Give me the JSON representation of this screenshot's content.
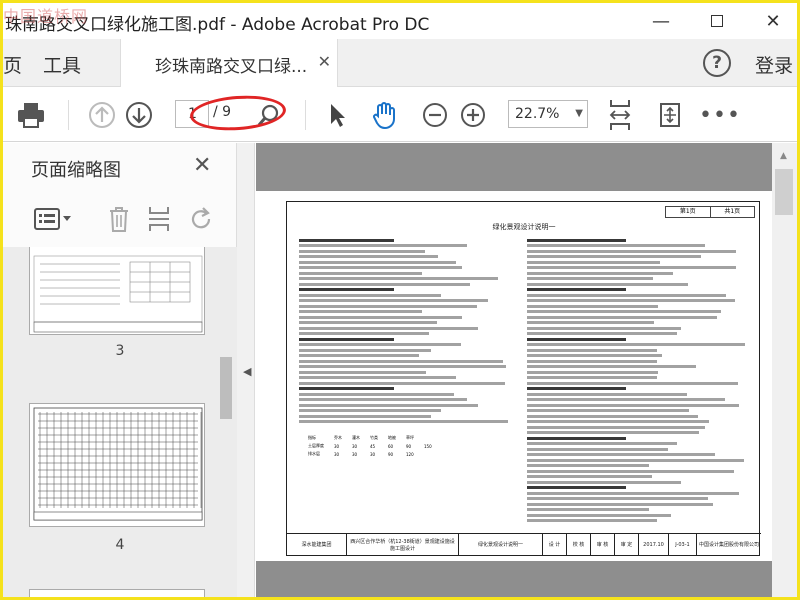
{
  "app": {
    "window_title": "珠南路交叉口绿化施工图.pdf - Adobe Acrobat Pro DC",
    "watermark": "中国道桥网"
  },
  "tabs": {
    "cut_left": "页",
    "tools": "工具",
    "doc_tab": "珍珠南路交叉口绿...",
    "login": "登录"
  },
  "toolbar": {
    "current_page": "1",
    "total_pages": "/ 9",
    "zoom": "22.7%"
  },
  "thumbnail_panel": {
    "title": "页面缩略图",
    "thumbnails": [
      {
        "label": "3"
      },
      {
        "label": "4"
      }
    ]
  },
  "document": {
    "header_cells": [
      "第1页",
      "共1页"
    ],
    "page_title": "绿化景观设计说明一",
    "title_block": {
      "company": "深水能建集团",
      "project": "西兴区合作华桥（杭12-38街道）景观建设施设施工图设计",
      "sheet_name": "绿化景观设计说明一",
      "roles": [
        "设 计",
        "校 核",
        "审 核",
        "审 定"
      ],
      "date": "2017.10",
      "drawing_no": "J-03-1",
      "designer": "中国设计集团股份有限公司"
    },
    "table": {
      "headers": [
        "指标",
        "乔木",
        "灌木",
        "竹类",
        "地被",
        "草坪"
      ],
      "rows": [
        [
          "土层厚度",
          "30",
          "30",
          "45",
          "60",
          "90",
          "150"
        ],
        [
          "排水层",
          "30",
          "30",
          "30",
          "90",
          "120"
        ]
      ]
    }
  },
  "colors": {
    "frame": "#f5e21c",
    "annotation_oval": "#e02525",
    "icon_gray": "#555555"
  }
}
